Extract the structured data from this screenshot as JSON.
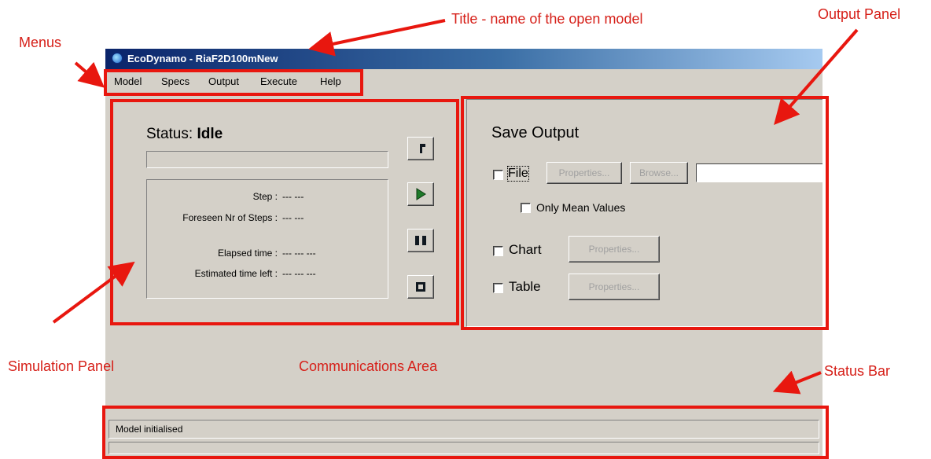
{
  "window": {
    "title": "EcoDynamo - RiaF2D100mNew"
  },
  "menu": [
    "Model",
    "Specs",
    "Output",
    "Execute",
    "Help"
  ],
  "simulation": {
    "status_label": "Status:",
    "status_value": "Idle",
    "step_label": "Step :",
    "step_value": "---   ---",
    "foreseen_label": "Foreseen Nr of Steps :",
    "foreseen_value": "---   ---",
    "elapsed_label": "Elapsed time :",
    "elapsed_value": "---   ---   ---",
    "estimated_label": "Estimated time left :",
    "estimated_value": "---   ---   ---",
    "toolbar_icons": [
      "step-icon",
      "play-icon",
      "pause-icon",
      "stop-icon"
    ]
  },
  "output": {
    "title": "Save Output",
    "file_label": "File",
    "properties_label": "Properties...",
    "browse_label": "Browse...",
    "file_path": "",
    "only_mean_label": "Only Mean Values",
    "chart_label": "Chart",
    "table_label": "Table"
  },
  "statusbar": {
    "text": "Model initialised"
  },
  "annotations": {
    "menus": "Menus",
    "title": "Title - name of the open model",
    "output_panel": "Output Panel",
    "simulation_panel": "Simulation Panel",
    "communications_area": "Communications Area",
    "status_bar": "Status Bar"
  },
  "colors": {
    "annotation_red": "#e8170f",
    "titlebar_dark": "#0a246a",
    "window_face": "#d4d0c8"
  }
}
